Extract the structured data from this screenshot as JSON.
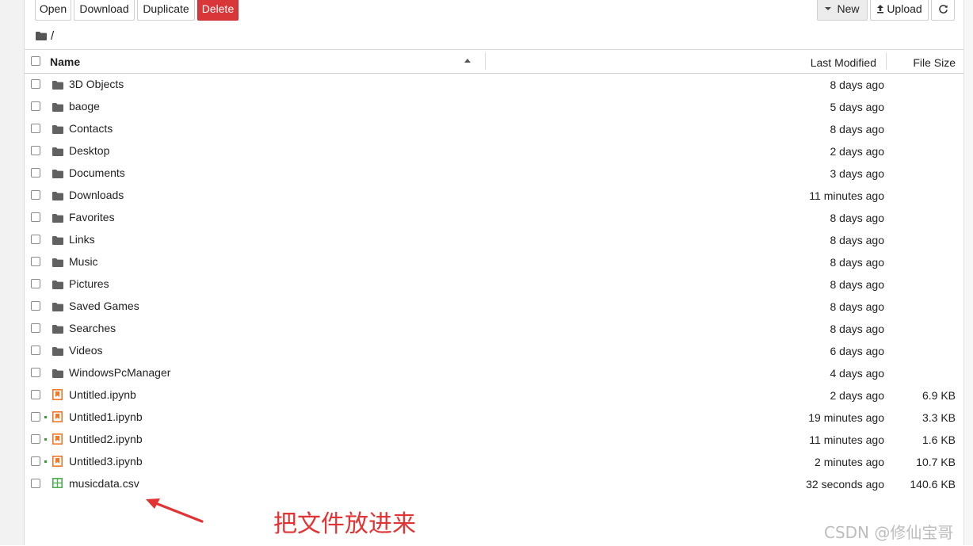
{
  "toolbar": {
    "open_label": "Open",
    "download_label": "Download",
    "duplicate_label": "Duplicate",
    "delete_label": "Delete",
    "new_label": "New",
    "upload_label": "Upload",
    "refresh_icon": "refresh-icon"
  },
  "breadcrumb": {
    "icon": "folder-icon",
    "path": "/"
  },
  "columns": {
    "name": "Name",
    "last_modified": "Last Modified",
    "file_size": "File Size"
  },
  "items": [
    {
      "name": "3D Objects",
      "type": "folder",
      "modified": "8 days ago",
      "size": "",
      "running": false
    },
    {
      "name": "baoge",
      "type": "folder",
      "modified": "5 days ago",
      "size": "",
      "running": false
    },
    {
      "name": "Contacts",
      "type": "folder",
      "modified": "8 days ago",
      "size": "",
      "running": false
    },
    {
      "name": "Desktop",
      "type": "folder",
      "modified": "2 days ago",
      "size": "",
      "running": false
    },
    {
      "name": "Documents",
      "type": "folder",
      "modified": "3 days ago",
      "size": "",
      "running": false
    },
    {
      "name": "Downloads",
      "type": "folder",
      "modified": "11 minutes ago",
      "size": "",
      "running": false
    },
    {
      "name": "Favorites",
      "type": "folder",
      "modified": "8 days ago",
      "size": "",
      "running": false
    },
    {
      "name": "Links",
      "type": "folder",
      "modified": "8 days ago",
      "size": "",
      "running": false
    },
    {
      "name": "Music",
      "type": "folder",
      "modified": "8 days ago",
      "size": "",
      "running": false
    },
    {
      "name": "Pictures",
      "type": "folder",
      "modified": "8 days ago",
      "size": "",
      "running": false
    },
    {
      "name": "Saved Games",
      "type": "folder",
      "modified": "8 days ago",
      "size": "",
      "running": false
    },
    {
      "name": "Searches",
      "type": "folder",
      "modified": "8 days ago",
      "size": "",
      "running": false
    },
    {
      "name": "Videos",
      "type": "folder",
      "modified": "6 days ago",
      "size": "",
      "running": false
    },
    {
      "name": "WindowsPcManager",
      "type": "folder",
      "modified": "4 days ago",
      "size": "",
      "running": false
    },
    {
      "name": "Untitled.ipynb",
      "type": "notebook",
      "modified": "2 days ago",
      "size": "6.9 KB",
      "running": false
    },
    {
      "name": "Untitled1.ipynb",
      "type": "notebook",
      "modified": "19 minutes ago",
      "size": "3.3 KB",
      "running": true
    },
    {
      "name": "Untitled2.ipynb",
      "type": "notebook",
      "modified": "11 minutes ago",
      "size": "1.6 KB",
      "running": true
    },
    {
      "name": "Untitled3.ipynb",
      "type": "notebook",
      "modified": "2 minutes ago",
      "size": "10.7 KB",
      "running": true
    },
    {
      "name": "musicdata.csv",
      "type": "csv",
      "modified": "32 seconds ago",
      "size": "140.6 KB",
      "running": false
    }
  ],
  "annotation": {
    "text": "把文件放进来",
    "color": "#e23434"
  },
  "watermark": "CSDN @修仙宝哥",
  "colors": {
    "danger": "#d9363a",
    "notebook": "#f37726",
    "csv": "#4caf50",
    "folder": "#616161",
    "running": "#3a9a3a"
  }
}
